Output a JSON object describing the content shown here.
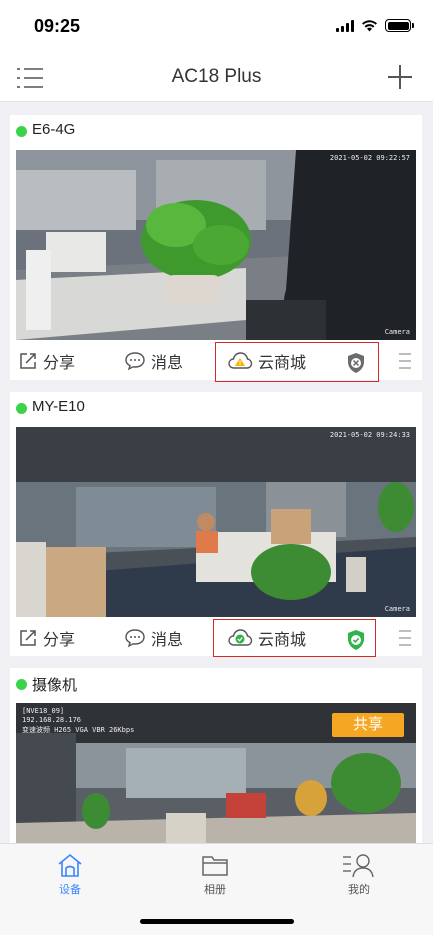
{
  "status_bar": {
    "time": "09:25"
  },
  "header": {
    "title": "AC18 Plus"
  },
  "devices": [
    {
      "name": "E6-4G",
      "osd_timestamp": "2021-05-02 09:22:57",
      "osd_label": "Camera",
      "actions": {
        "share": "分享",
        "message": "消息",
        "cloud": "云商城"
      },
      "cloud_status": "warning",
      "shield_status": "inactive"
    },
    {
      "name": "MY-E10",
      "osd_timestamp": "2021-05-02 09:24:33",
      "osd_label": "Camera",
      "actions": {
        "share": "分享",
        "message": "消息",
        "cloud": "云商城"
      },
      "cloud_status": "active",
      "shield_status": "active"
    },
    {
      "name": "摄像机",
      "osd_lines": [
        "[NVE18_09]",
        "192.168.28.176",
        "变速波频 H265 VGA VBR 26Kbps"
      ],
      "share_badge": "共享"
    }
  ],
  "tabs": [
    {
      "label": "设备",
      "icon": "home-icon",
      "active": true
    },
    {
      "label": "相册",
      "icon": "folder-icon",
      "active": false
    },
    {
      "label": "我的",
      "icon": "user-icon",
      "active": false
    }
  ],
  "colors": {
    "online": "#3bd34a",
    "active_tab": "#3a86ff",
    "share_badge": "#f5a623",
    "highlight_box": "#d42a2a",
    "shield_active": "#2fb34a"
  }
}
